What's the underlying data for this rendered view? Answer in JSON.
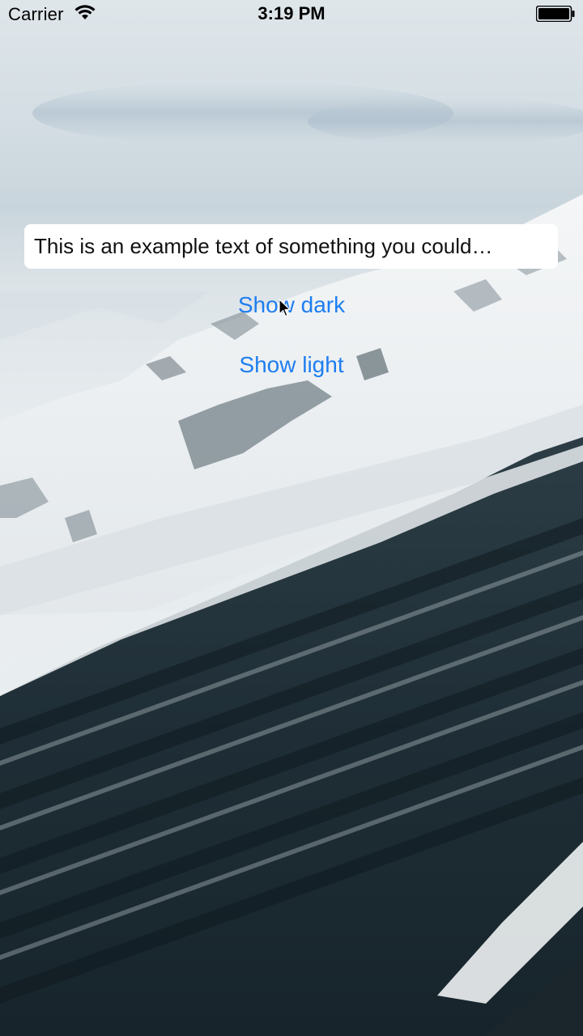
{
  "status_bar": {
    "carrier": "Carrier",
    "time": "3:19 PM",
    "wifi_icon": "wifi-icon",
    "battery_icon": "battery-icon"
  },
  "text_field": {
    "value": "This is an example text of something you could…"
  },
  "buttons": {
    "show_dark": "Show dark",
    "show_light": "Show light"
  },
  "colors": {
    "accent": "#1e7ef0",
    "field_background": "#ffffff",
    "status_text": "#000000"
  }
}
